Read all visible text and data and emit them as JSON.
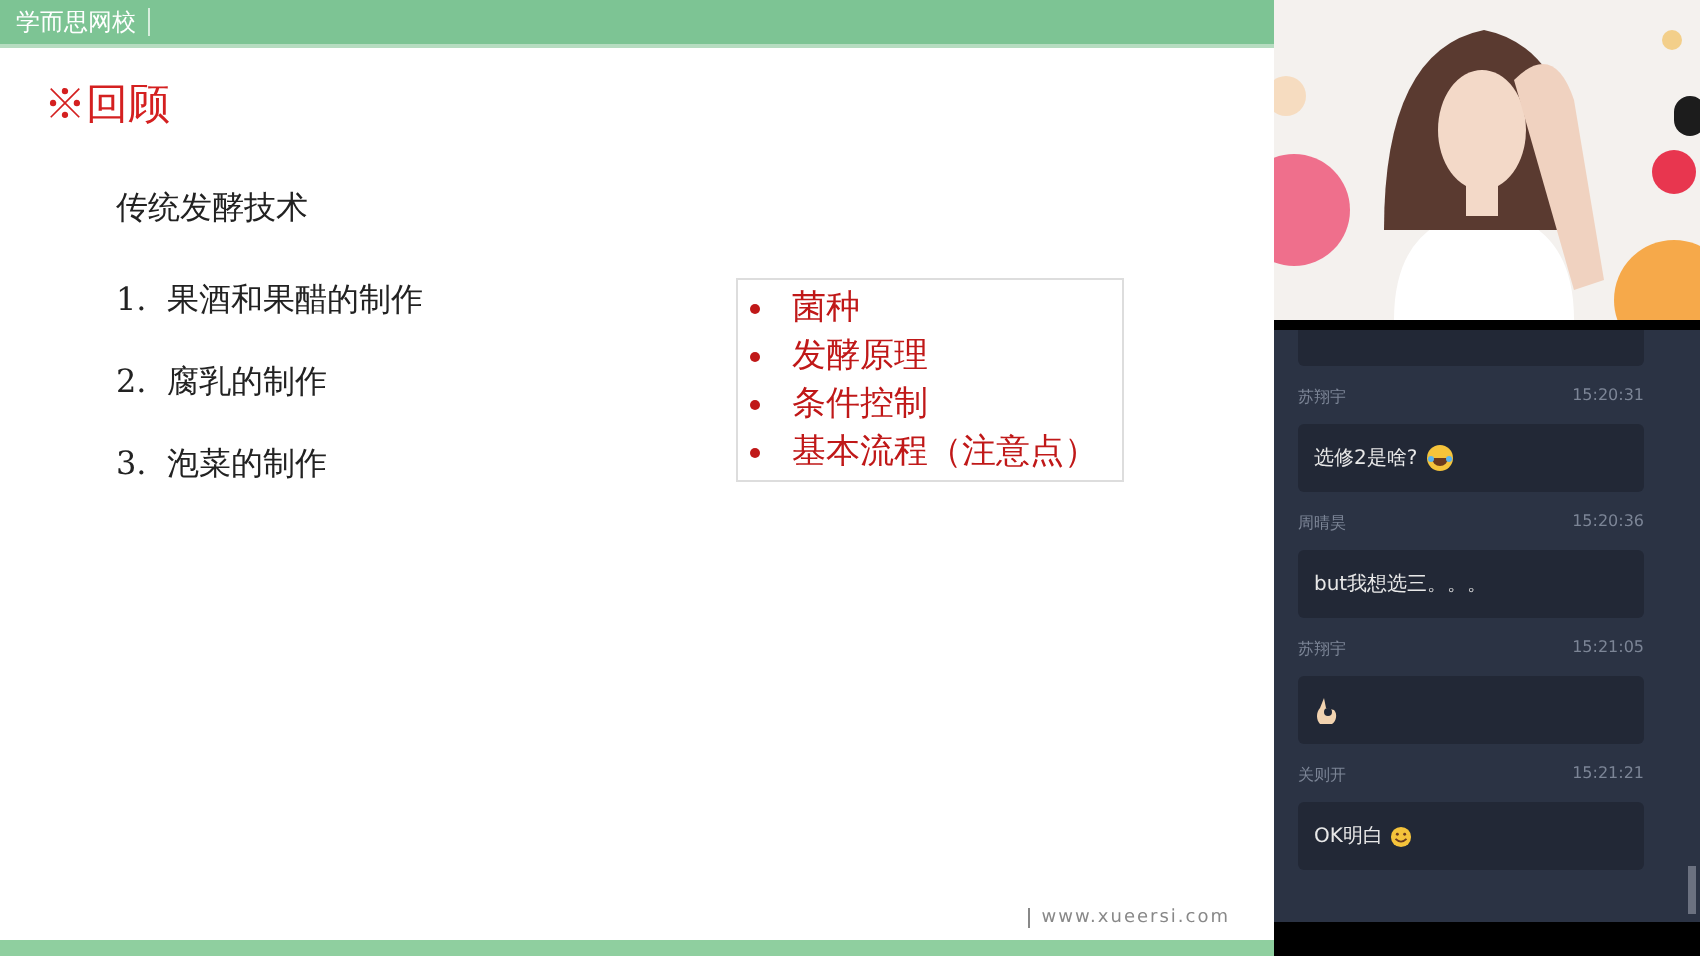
{
  "slide": {
    "logo": "学而思网校",
    "title": "※回顾",
    "subtitle": "传统发酵技术",
    "items": [
      {
        "number": "1.",
        "text": "果酒和果醋的制作"
      },
      {
        "number": "2.",
        "text": "腐乳的制作"
      },
      {
        "number": "3.",
        "text": "泡菜的制作"
      }
    ],
    "bullets": [
      "菌种",
      "发酵原理",
      "条件控制",
      "基本流程（注意点）"
    ],
    "website": "www.xueersi.com"
  },
  "chat": {
    "messages": [
      {
        "kind": "partial"
      },
      {
        "kind": "text",
        "sender": "苏翔宇",
        "time": "15:20:31",
        "text": "选修2是啥?",
        "emoji": {
          "kind": "laugh"
        }
      },
      {
        "kind": "text",
        "sender": "周晴昊",
        "time": "15:20:36",
        "text": "but我想选三。。。"
      },
      {
        "kind": "text",
        "sender": "苏翔宇",
        "time": "15:21:05",
        "emoji": {
          "kind": "ok"
        }
      },
      {
        "kind": "text",
        "sender": "关则开",
        "time": "15:21:21",
        "text": "OK明白",
        "emoji": {
          "kind": "smile"
        }
      }
    ]
  }
}
